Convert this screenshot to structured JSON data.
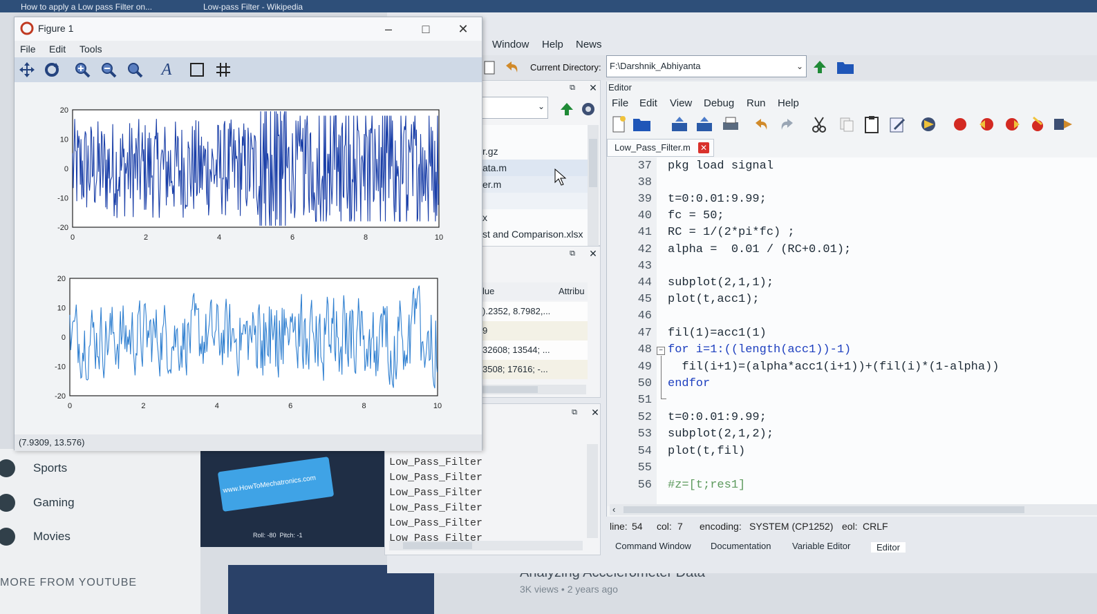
{
  "browser": {
    "tabs": [
      "How to apply a Low pass Filter on...",
      "Low-pass Filter - Wikipedia"
    ]
  },
  "youtube": {
    "sidebar_items": [
      "Sports",
      "Gaming",
      "Movies"
    ],
    "more_from": "MORE FROM YOUTUBE",
    "thumb_url": "www.HowToMechatronics.com",
    "thumb_caption_left": "Roll: -80",
    "thumb_caption_right": "Pitch: -1",
    "video_title": "Analyzing Accelerometer Data",
    "video_meta": "3K views • 2 years ago"
  },
  "octave": {
    "menu": [
      "Window",
      "Help",
      "News"
    ],
    "current_directory_label": "Current Directory:",
    "current_directory": "F:\\Darshnik_Abhiyanta",
    "file_browser": {
      "rows": [
        "r.gz",
        "ata.m",
        "er.m",
        "",
        "x",
        "st and Comparison.xlsx"
      ]
    },
    "workspace": {
      "headers": [
        "lue",
        "Attribu"
      ],
      "rows": [
        ").2352, 8.7982,...",
        "9",
        "32608; 13544; ...",
        "3508; 17616; -..."
      ]
    },
    "history": {
      "rows": [
        "Low_Pass_Filter",
        "Low_Pass_Filter",
        "Low_Pass_Filter",
        "Low_Pass_Filter",
        "Low_Pass_Filter",
        "Low_Pass_Filter"
      ]
    },
    "editor": {
      "title": "Editor",
      "menu": [
        "File",
        "Edit",
        "View",
        "Debug",
        "Run",
        "Help"
      ],
      "tab": "Low_Pass_Filter.m",
      "lines": [
        {
          "n": "37",
          "code": "pkg load signal"
        },
        {
          "n": "38",
          "code": ""
        },
        {
          "n": "39",
          "code": "t=0:0.01:9.99;"
        },
        {
          "n": "40",
          "code": "fc = 50;"
        },
        {
          "n": "41",
          "code": "RC = 1/(2*pi*fc) ;"
        },
        {
          "n": "42",
          "code": "alpha =  0.01 / (RC+0.01);"
        },
        {
          "n": "43",
          "code": ""
        },
        {
          "n": "44",
          "code": "subplot(2,1,1);"
        },
        {
          "n": "45",
          "code": "plot(t,acc1);"
        },
        {
          "n": "46",
          "code": ""
        },
        {
          "n": "47",
          "code": "fil(1)=acc1(1)"
        },
        {
          "n": "48",
          "code": "for i=1:((length(acc1))-1)"
        },
        {
          "n": "49",
          "code": "  fil(i+1)=(alpha*acc1(i+1))+(fil(i)*(1-alpha))"
        },
        {
          "n": "50",
          "code": "endfor"
        },
        {
          "n": "51",
          "code": ""
        },
        {
          "n": "52",
          "code": "t=0:0.01:9.99;"
        },
        {
          "n": "53",
          "code": "subplot(2,1,2);"
        },
        {
          "n": "54",
          "code": "plot(t,fil)"
        },
        {
          "n": "55",
          "code": ""
        },
        {
          "n": "56",
          "code": "#z=[t;res1]"
        }
      ],
      "status": {
        "line_label": "line:",
        "line": "54",
        "col_label": "col:",
        "col": "7",
        "encoding_label": "encoding:",
        "encoding": "SYSTEM (CP1252)",
        "eol_label": "eol:",
        "eol": "CRLF"
      },
      "bottom_tabs": [
        "Command Window",
        "Documentation",
        "Variable Editor",
        "Editor"
      ]
    }
  },
  "figure": {
    "title": "Figure 1",
    "menu": [
      "File",
      "Edit",
      "Tools"
    ],
    "status": "(7.9309, 13.576)"
  },
  "chart_data": [
    {
      "type": "line",
      "xlim": [
        0,
        10
      ],
      "ylim": [
        -20,
        20
      ],
      "xticks": [
        "0",
        "2",
        "4",
        "6",
        "8",
        "10"
      ],
      "yticks": [
        "20",
        "10",
        "0",
        "-10",
        "-20"
      ],
      "series_color": "#1a3fa8",
      "description_values": {
        "x_start": 0,
        "x_end": 9.99,
        "step": 0.01
      }
    },
    {
      "type": "line",
      "xlim": [
        0,
        10
      ],
      "ylim": [
        -20,
        20
      ],
      "xticks": [
        "0",
        "2",
        "4",
        "6",
        "8",
        "10"
      ],
      "yticks": [
        "20",
        "10",
        "0",
        "-10",
        "-20"
      ],
      "series_color": "#2f7fd0",
      "description_values": {
        "x_start": 0,
        "x_end": 9.99,
        "step": 0.01
      }
    }
  ],
  "colors": {
    "accent": "#1d3fbf",
    "close_tab": "#d9312b"
  }
}
